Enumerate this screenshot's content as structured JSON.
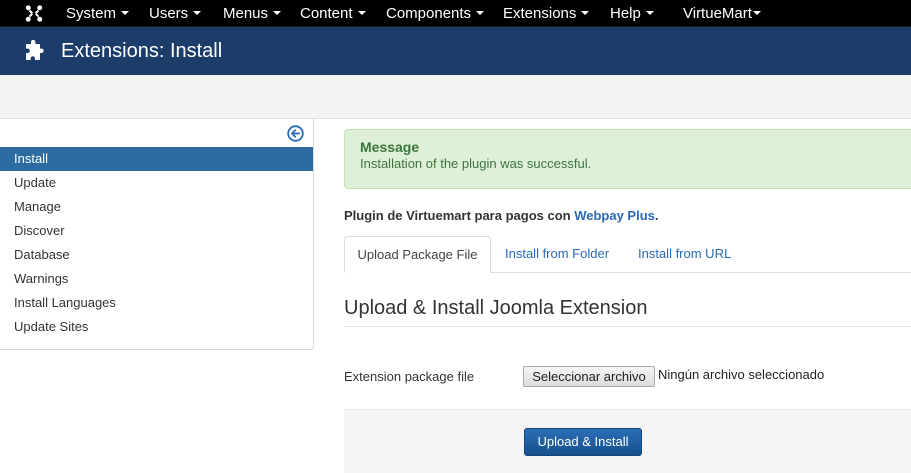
{
  "navbar": {
    "items": [
      {
        "label": "System"
      },
      {
        "label": "Users"
      },
      {
        "label": "Menus"
      },
      {
        "label": "Content"
      },
      {
        "label": "Components"
      },
      {
        "label": "Extensions"
      },
      {
        "label": "Help"
      },
      {
        "label": "VirtueMart"
      }
    ]
  },
  "header": {
    "title": "Extensions: Install",
    "icon": "puzzle-icon"
  },
  "sidebar": {
    "collapse_icon": "arrow-left-circle-icon",
    "items": [
      {
        "label": "Install",
        "active": true
      },
      {
        "label": "Update"
      },
      {
        "label": "Manage"
      },
      {
        "label": "Discover"
      },
      {
        "label": "Database"
      },
      {
        "label": "Warnings"
      },
      {
        "label": "Install Languages"
      },
      {
        "label": "Update Sites"
      }
    ]
  },
  "alert": {
    "heading": "Message",
    "text": "Installation of the plugin was successful."
  },
  "plugin": {
    "prefix": "Plugin de Virtuemart para pagos con ",
    "link": "Webpay Plus",
    "suffix": "."
  },
  "tabs": [
    {
      "label": "Upload Package File",
      "active": true
    },
    {
      "label": "Install from Folder"
    },
    {
      "label": "Install from URL"
    }
  ],
  "section": {
    "title": "Upload & Install Joomla Extension"
  },
  "form": {
    "field_label": "Extension package file",
    "file_button": "Seleccionar archivo",
    "file_status": "Ningún archivo seleccionado",
    "submit_label": "Upload & Install"
  },
  "colors": {
    "navbar": "#000000",
    "header": "#1c3d6a",
    "sidebar_active": "#2d6ca2",
    "alert_bg": "#dff0d8",
    "alert_text": "#3c763d",
    "link": "#2a69b8",
    "primary_button": "#1f5f9f"
  }
}
